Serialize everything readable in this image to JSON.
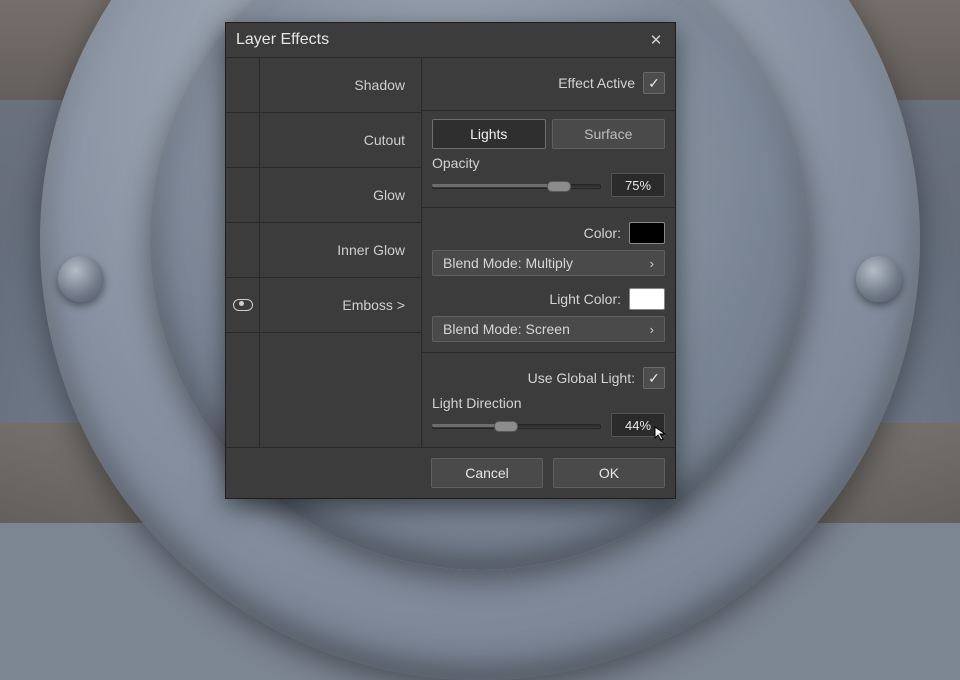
{
  "dialog": {
    "title": "Layer Effects",
    "effect_active_label": "Effect Active",
    "effect_active_checked": true,
    "effects": [
      {
        "label": "Shadow",
        "visible": false,
        "expanded": false
      },
      {
        "label": "Cutout",
        "visible": false,
        "expanded": false
      },
      {
        "label": "Glow",
        "visible": false,
        "expanded": false
      },
      {
        "label": "Inner Glow",
        "visible": false,
        "expanded": false
      },
      {
        "label": "Emboss",
        "visible": true,
        "expanded": true,
        "display": "Emboss  >"
      }
    ],
    "tabs": {
      "lights": "Lights",
      "surface": "Surface",
      "active": "lights"
    },
    "opacity": {
      "label": "Opacity",
      "value": "75%",
      "percent": 75
    },
    "color": {
      "label": "Color:",
      "value": "#000000"
    },
    "blend1": {
      "label": "Blend Mode: Multiply"
    },
    "light_color": {
      "label": "Light Color:",
      "value": "#ffffff"
    },
    "blend2": {
      "label": "Blend Mode: Screen"
    },
    "global_light": {
      "label": "Use Global Light:",
      "checked": true
    },
    "light_dir": {
      "label": "Light Direction",
      "value": "44%",
      "percent": 44
    },
    "buttons": {
      "cancel": "Cancel",
      "ok": "OK"
    }
  }
}
